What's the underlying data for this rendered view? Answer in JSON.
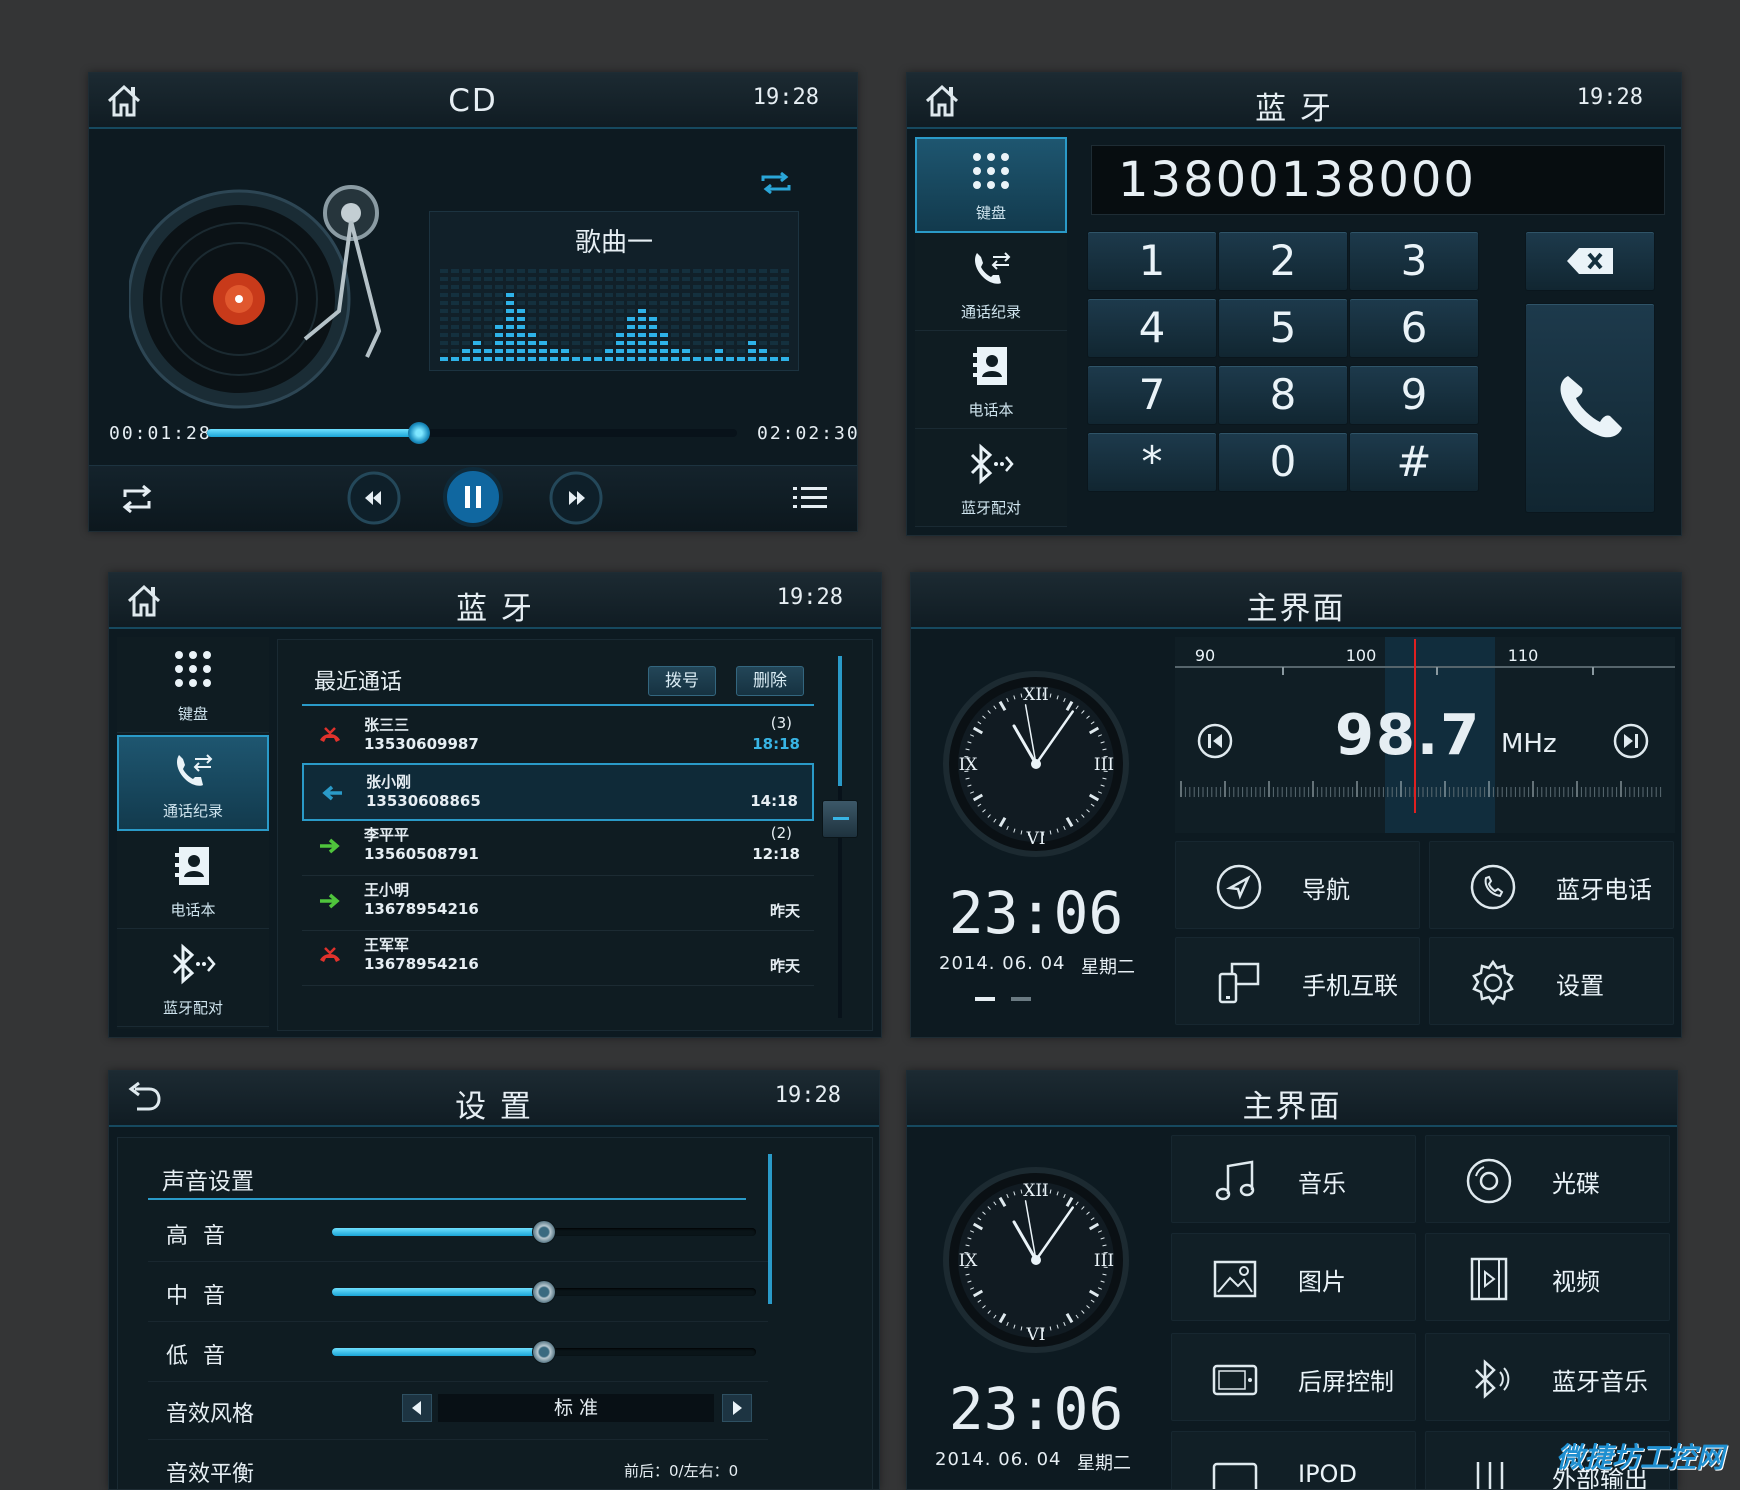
{
  "cd": {
    "title": "CD",
    "time": "19:28",
    "song": "歌曲一",
    "elapsed": "00:01:28",
    "total": "02:02:30",
    "progress": 0.4
  },
  "dialer": {
    "title": "蓝 牙",
    "time": "19:28",
    "number": "13800138000",
    "sidebar": [
      "键盘",
      "通话纪录",
      "电话本",
      "蓝牙配对"
    ],
    "keys": [
      "1",
      "2",
      "3",
      "4",
      "5",
      "6",
      "7",
      "8",
      "9",
      "*",
      "0",
      "#"
    ]
  },
  "calls": {
    "title": "蓝 牙",
    "time": "19:28",
    "heading": "最近通话",
    "dial_label": "拨号",
    "delete_label": "删除",
    "sidebar": [
      "键盘",
      "通话纪录",
      "电话本",
      "蓝牙配对"
    ],
    "rows": [
      {
        "name": "张三三",
        "phone": "13530609987",
        "count": "(3)",
        "time": "18:18",
        "kind": "missed"
      },
      {
        "name": "张小刚",
        "phone": "13530608865",
        "count": "",
        "time": "14:18",
        "kind": "incoming"
      },
      {
        "name": "李平平",
        "phone": "13560508791",
        "count": "(2)",
        "time": "12:18",
        "kind": "outgoing"
      },
      {
        "name": "王小明",
        "phone": "13678954216",
        "count": "",
        "time": "昨天",
        "kind": "outgoing"
      },
      {
        "name": "王军军",
        "phone": "13678954216",
        "count": "",
        "time": "昨天",
        "kind": "missed"
      }
    ]
  },
  "home1": {
    "title": "主界面",
    "clock": "23:06",
    "date": "2014. 06. 04",
    "weekday": "星期二",
    "radio": {
      "freq": "98.7",
      "unit": "MHz",
      "ticks": [
        "90",
        "100",
        "110"
      ]
    },
    "tiles": [
      "导航",
      "蓝牙电话",
      "手机互联",
      "设置"
    ]
  },
  "settings": {
    "title": "设 置",
    "time": "19:28",
    "heading": "声音设置",
    "sliders": [
      {
        "label": "高 音",
        "value": 0.5
      },
      {
        "label": "中 音",
        "value": 0.5
      },
      {
        "label": "低 音",
        "value": 0.5
      }
    ],
    "effect_label": "音效风格",
    "effect_value": "标 准",
    "balance_label": "音效平衡",
    "balance_value": "前后：0/左右：0"
  },
  "home2": {
    "title": "主界面",
    "clock": "23:06",
    "date": "2014. 06. 04",
    "weekday": "星期二",
    "tiles": [
      "音乐",
      "光碟",
      "图片",
      "视频",
      "后屏控制",
      "蓝牙音乐",
      "IPOD",
      "外部输出"
    ]
  },
  "roman": [
    "XII",
    "III",
    "VI",
    "IX"
  ],
  "watermark": "微捷坊工控网",
  "colors": {
    "accent": "#2a9ac8",
    "missed": "#e0322c",
    "outgoing": "#4fc43c",
    "needle": "#e02020"
  }
}
